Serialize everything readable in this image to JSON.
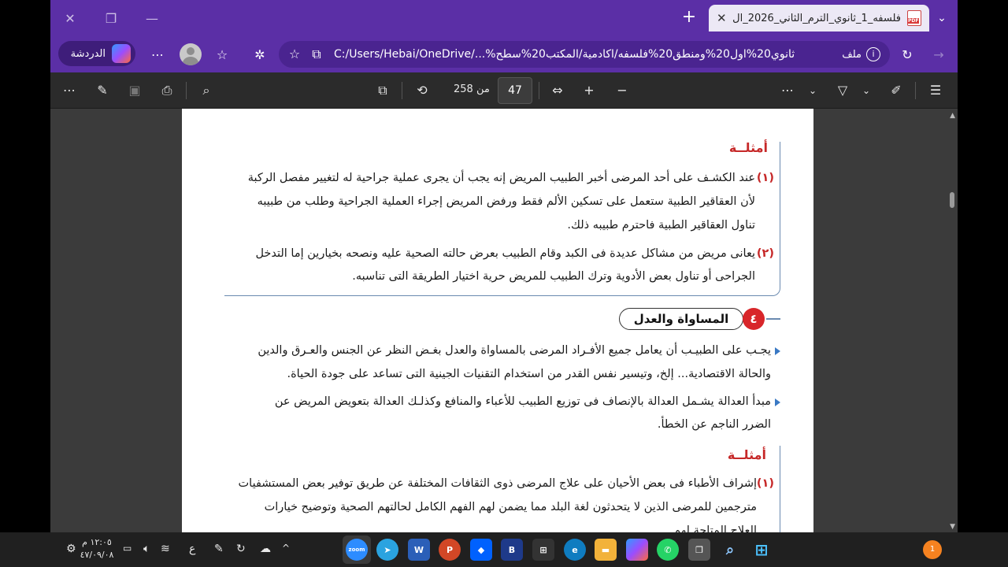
{
  "browser": {
    "tab_title": "فلسفه_1_ثانوي_الترم_الثاني_2026_ال",
    "url": "C:/Users/Hebai/OneDrive/...%ثانوي20%اول20%ومنطق20%فلسفه/اكادمية/المكتب20%سطح",
    "file_label": "ملف",
    "chat_label": "الدردشة"
  },
  "pdf_toolbar": {
    "current_page": "47",
    "total_pages_label": "من 258"
  },
  "page": {
    "examples_heading_1": "أمثلــة",
    "example1_lines": [
      "عند الكشـف على أحد المرضى أخبر الطبيب المريض إنه يجب أن يجرى عملية جراحية له لتغيير مفصل الركبة",
      "لأن العقاقير الطبية ستعمل على تسكين الألم فقط ورفض المريض إجراء العملية الجراحية وطلب من طبيبه",
      "تناول العقاقير الطبية فاحترم طبيبه ذلك."
    ],
    "example1_num": "(١)",
    "example2_lines": [
      "يعانى مريض من مشاكل عديدة فى الكبد وقام الطبيب بعرض حالته الصحية عليه ونصحه بخيارين إما التدخل",
      "الجراحى أو تناول بعض الأدوية وترك الطبيب للمريض حرية  اختيار الطريقة التى تناسبه."
    ],
    "example2_num": "(٢)",
    "section_number": "٤",
    "section_title": "المساواة والعدل",
    "bullet1_lines": [
      "يجـب على الطبيـب أن يعامل جميع الأفـراد المرضى بالمساواة والعدل بغـض النظر عن الجنس والعـرق والدين",
      "والحالة الاقتصادية... إلخ، وتيسير نفس القدر من استخدام التقنيات الجينية التى تساعد على جودة الحياة."
    ],
    "bullet2_lines": [
      "مبدأ العدالة يشـمل العدالة بالإنصاف فى توزيع الطبيب للأعباء والمنافع وكذلـك العدالة بتعويض المريض عن",
      "الضرر الناجم عن الخطأ."
    ],
    "examples_heading_2": "أمثلــة",
    "example3_num": "(١)",
    "example3_lines": [
      "إشراف الأطباء فى بعض الأحيان على علاج المرضى ذوى الثقافات المختلفة عن طريق توفير بعض المستشفيات",
      "مترجمين للمرضى الذين لا يتحدثون لغة البلد مما يضمن لهم الفهم الكامل لحالتهم الصحية وتوضيح خيارات",
      "العلاج المتاحة لهم."
    ]
  },
  "taskbar": {
    "time": "١٢:٠٥ م",
    "date": "٤٧/٠٩/٠٨",
    "lang": "ع",
    "notification_count": "1"
  },
  "colors": {
    "titlebar": "#5b2fa6",
    "heading_red": "#c62828",
    "frame_blue": "#6a8ab0"
  }
}
